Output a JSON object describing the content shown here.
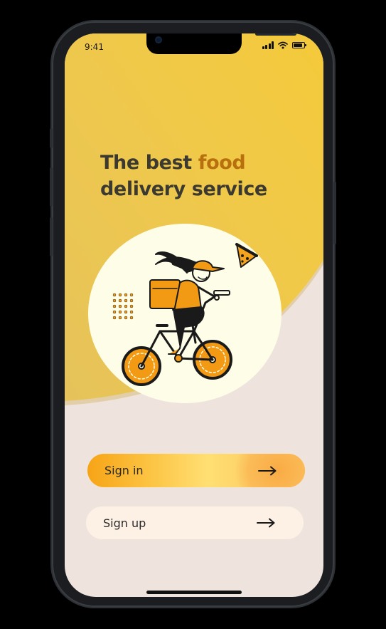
{
  "status_bar": {
    "time": "9:41",
    "signal_icon": "cellular-signal-icon",
    "wifi_icon": "wifi-icon",
    "battery_icon": "battery-icon",
    "battery_level": 0.85
  },
  "hero": {
    "headline_part1": "The best ",
    "headline_accent": "food",
    "headline_part2": "delivery service",
    "illustration": "courier-on-bicycle-with-pizza-illustration"
  },
  "actions": {
    "sign_in_label": "Sign in",
    "sign_up_label": "Sign up",
    "arrow_icon": "arrow-right-icon"
  },
  "colors": {
    "background": "#000000",
    "hero_yellow": "#f2c83f",
    "screen_cream": "#efe4dd",
    "headline": "#3c3a30",
    "accent": "#b8700e",
    "sign_in_gradient_start": "#f7a416",
    "sign_in_gradient_end": "#ffdf73",
    "sign_up_background": "#fdf1e6",
    "illustration_orange": "#f29a14"
  }
}
